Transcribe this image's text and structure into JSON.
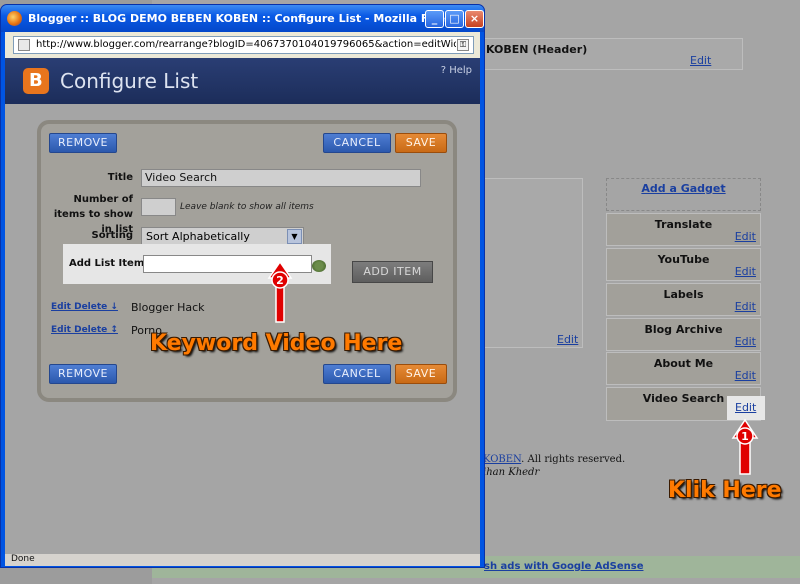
{
  "background": {
    "header_widget_text": "KOBEN (Header)",
    "edit_label": "Edit",
    "add_gadget_label": "Add a Gadget",
    "gadgets": [
      {
        "name": "Translate",
        "edit": "Edit"
      },
      {
        "name": "YouTube",
        "edit": "Edit"
      },
      {
        "name": "Labels",
        "edit": "Edit"
      },
      {
        "name": "Blog Archive",
        "edit": "Edit"
      },
      {
        "name": "About Me",
        "edit": "Edit"
      },
      {
        "name": "Video Search",
        "edit": "Edit"
      }
    ],
    "footer_link": "KOBEN",
    "footer_rights": ". All rights reserved.",
    "footer_author": "ihan Khedr",
    "adsense_link": "sh ads with Google AdSense"
  },
  "window": {
    "title": "Blogger :: BLOG DEMO BEBEN KOBEN :: Configure List - Mozilla Firefox",
    "url": "http://www.blogger.com/rearrange?blogID=4067370104019796065&action=editWidget&sectionId=sidet",
    "status": "Done"
  },
  "dialog": {
    "title": "Configure List",
    "help": "? Help",
    "remove_label": "REMOVE",
    "cancel_label": "CANCEL",
    "save_label": "SAVE",
    "title_label": "Title",
    "title_value": "Video Search",
    "items_label": "Number of items to show in list",
    "items_value": "",
    "items_hint": "Leave blank to show all items",
    "sorting_label": "Sorting",
    "sorting_value": "Sort Alphabetically",
    "add_list_item_label": "Add List Item",
    "add_list_item_value": "",
    "add_item_button": "ADD ITEM",
    "list_items": [
      {
        "links": "Edit Delete ↓",
        "name": "Blogger Hack"
      },
      {
        "links": "Edit Delete ↕",
        "name": "Porno"
      }
    ]
  },
  "annotations": {
    "keyword_text": "Keyword Video Here",
    "klik_text": "Klik Here",
    "step1": "1",
    "step2": "2"
  },
  "colors": {
    "arrow_red": "#e00000",
    "annotation_orange": "#ff7a00",
    "blue_button": "#3a67c0",
    "save_orange": "#d97a22"
  }
}
